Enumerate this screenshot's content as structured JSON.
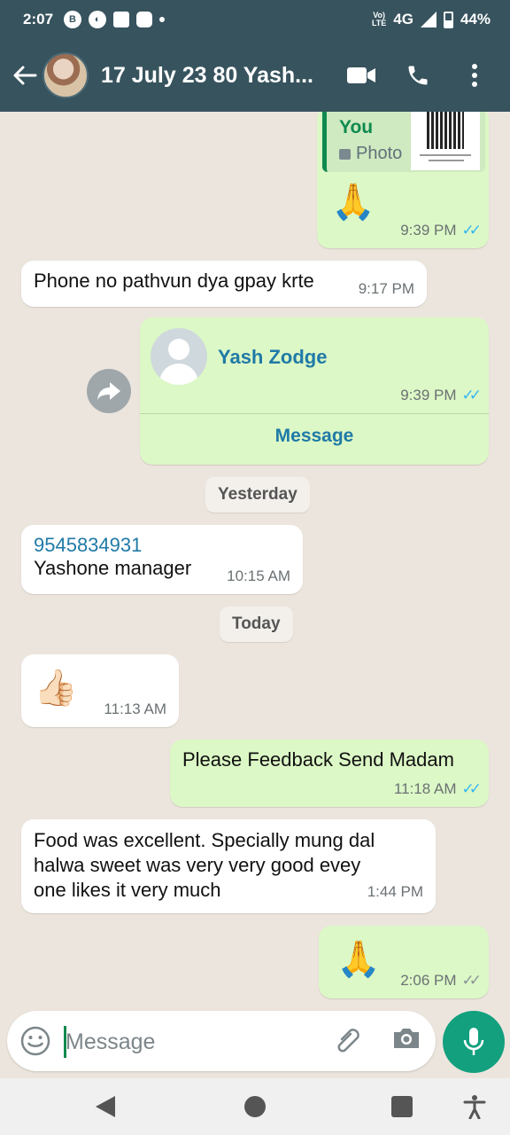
{
  "status_bar": {
    "time": "2:07",
    "network": "4G",
    "volte_label": "Vo)) LTE",
    "battery": "44%"
  },
  "header": {
    "title": "17 July 23 80 Yash...",
    "icons": [
      "back-arrow-icon",
      "video-call-icon",
      "phone-icon",
      "more-options-icon"
    ]
  },
  "messages": {
    "m1": {
      "quote_author": "You",
      "quote_type": "Photo",
      "emoji": "🙏",
      "time": "9:39 PM",
      "status": "read"
    },
    "m2": {
      "text": "Phone no pathvun dya gpay krte",
      "time": "9:17 PM"
    },
    "m3": {
      "contact_name": "Yash Zodge",
      "time": "9:39 PM",
      "action": "Message",
      "status": "read"
    },
    "date1": "Yesterday",
    "m4": {
      "phone": "9545834931",
      "text": "Yashone manager",
      "time": "10:15 AM"
    },
    "date2": "Today",
    "m5": {
      "emoji": "👍🏻",
      "time": "11:13 AM"
    },
    "m6": {
      "text": "Please Feedback Send Madam",
      "time": "11:18 AM",
      "status": "read"
    },
    "m7": {
      "text": "Food was excellent. Specially mung dal halwa sweet was very very good evey one likes it very much",
      "time": "1:44 PM"
    },
    "m8": {
      "emoji": "🙏",
      "time": "2:06 PM",
      "status": "delivered"
    }
  },
  "input": {
    "placeholder": "Message"
  },
  "colors": {
    "header": "#37535e",
    "chat_bg": "#ece5dd",
    "outgoing": "#dcf8c6",
    "incoming": "#ffffff",
    "accent": "#12a07f",
    "read_ticks": "#34b7f1"
  }
}
